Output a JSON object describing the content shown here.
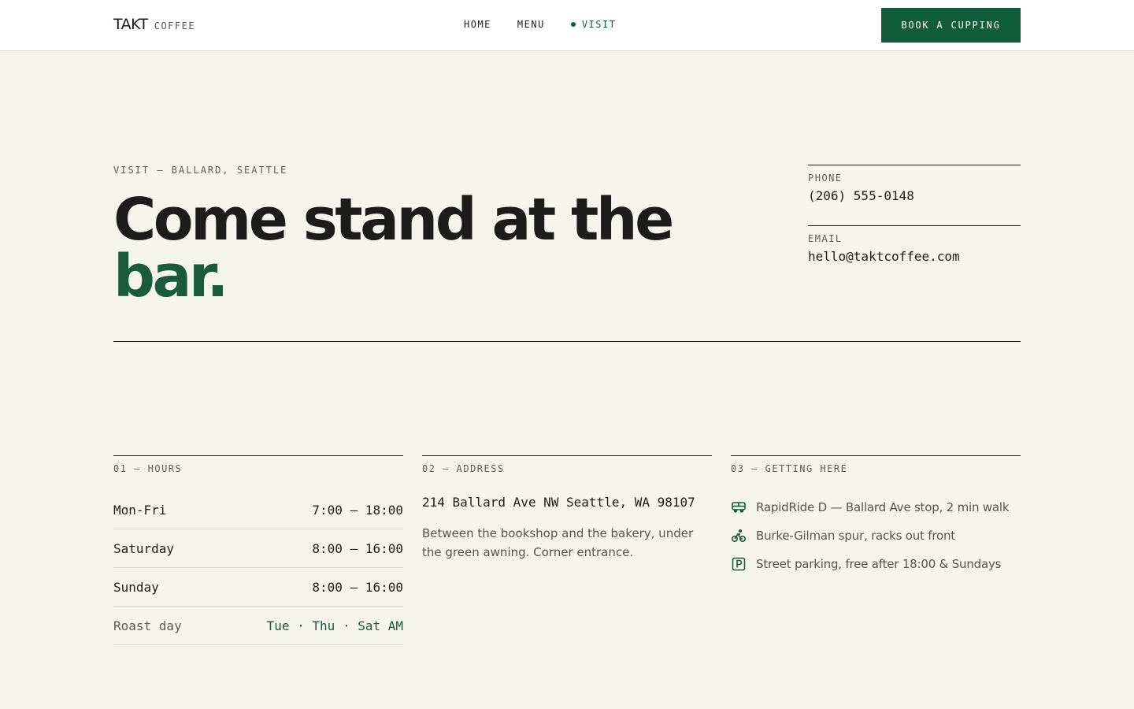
{
  "header": {
    "brand_name": "TAKT",
    "brand_sub": "COFFEE",
    "nav": [
      {
        "label": "HOME"
      },
      {
        "label": "MENU"
      },
      {
        "label": "VISIT"
      }
    ],
    "cta_label": "BOOK A CUPPING"
  },
  "hero": {
    "eyebrow": "VISIT — BALLARD, SEATTLE",
    "headline_line1": "Come stand at the",
    "headline_accent": "bar."
  },
  "contact": {
    "phone_label": "PHONE",
    "phone_value": "(206) 555-0148",
    "email_label": "EMAIL",
    "email_value": "hello@taktcoffee.com"
  },
  "hours": {
    "label": "01 — HOURS",
    "rows": [
      {
        "day": "Mon-Fri",
        "time": "7:00 – 18:00"
      },
      {
        "day": "Saturday",
        "time": "8:00 – 16:00"
      },
      {
        "day": "Sunday",
        "time": "8:00 – 16:00"
      },
      {
        "day": "Roast day",
        "time": "Tue · Thu · Sat AM"
      }
    ]
  },
  "address": {
    "label": "02 — ADDRESS",
    "line": "214 Ballard Ave NW Seattle, WA 98107",
    "note": "Between the bookshop and the bakery, under the green awning. Corner entrance."
  },
  "getting_here": {
    "label": "03 — GETTING HERE",
    "items": [
      {
        "icon": "bus-icon",
        "text": "RapidRide D — Ballard Ave stop, 2 min walk"
      },
      {
        "icon": "bike-icon",
        "text": "Burke-Gilman spur, racks out front"
      },
      {
        "icon": "parking-icon",
        "text": "Street parking, free after 18:00 & Sundays"
      }
    ]
  },
  "colors": {
    "accent": "#115c3d",
    "background": "#f5f4ef",
    "text": "#1c1c1a"
  }
}
